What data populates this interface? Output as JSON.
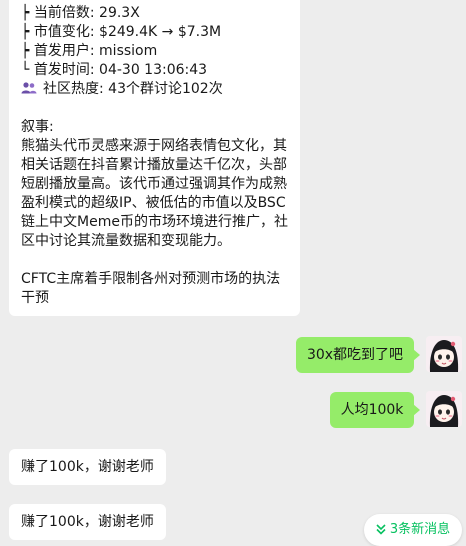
{
  "token_card": {
    "top_line_partial": "┝ 当前倍数: 29.3X",
    "lines": [
      "┝ 当前倍数: 29.3X",
      "┝ 市值变化: $249.4K → $7.3M",
      "┝ 首发用户: missiom",
      "└ 首发时间: 04-30 13:06:43"
    ],
    "community": "社区热度: 43个群讨论102次",
    "narrative_title": "叙事:",
    "narrative_body": "熊猫头代币灵感来源于网络表情包文化，其相关话题在抖音累计播放量达千亿次，头部短剧播放量高。该代币通过强调其作为成熟盈利模式的超级IP、被低估的市值以及BSC链上中文Meme币的市场环境进行推广，社区中讨论其流量数据和变现能力。",
    "news": "CFTC主席着手限制各州对预测市场的执法干预"
  },
  "messages": [
    {
      "side": "out",
      "text": "30x都吃到了吧"
    },
    {
      "side": "out",
      "text": "人均100k"
    },
    {
      "side": "in",
      "text": "赚了100k，谢谢老师"
    },
    {
      "side": "in",
      "text": "赚了100k，谢谢老师"
    }
  ],
  "new_messages_label": "3条新消息",
  "colors": {
    "self_bubble": "#95ec69",
    "accent": "#07c160",
    "background": "#ededed"
  },
  "icons": {
    "community": "people-icon",
    "new_messages": "double-chevron-down-icon",
    "avatar": "anime-girl-avatar"
  }
}
